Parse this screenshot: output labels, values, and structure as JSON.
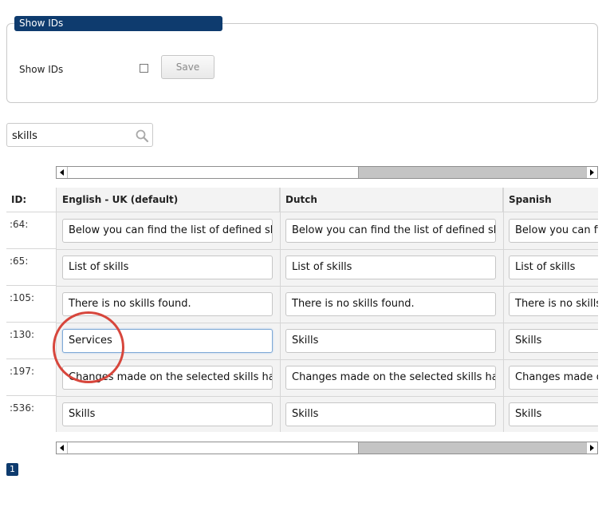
{
  "show_ids_panel": {
    "legend": "Show IDs",
    "label": "Show IDs",
    "checked": false,
    "save_label": "Save"
  },
  "search": {
    "value": "skills",
    "icon": "search-icon"
  },
  "table": {
    "id_header": "ID:",
    "columns": [
      "English - UK (default)",
      "Dutch",
      "Spanish"
    ],
    "rows": [
      {
        "id": ":64:",
        "values": [
          "Below you can find the list of defined sk",
          "Below you can find the list of defined sk",
          "Below you can fin"
        ]
      },
      {
        "id": ":65:",
        "values": [
          "List of skills",
          "List of skills",
          "List of skills"
        ]
      },
      {
        "id": ":105:",
        "values": [
          "There is no skills found.",
          "There is no skills found.",
          "There is no skills"
        ]
      },
      {
        "id": ":130:",
        "values": [
          "Services",
          "Skills",
          "Skills"
        ]
      },
      {
        "id": ":197:",
        "values": [
          "Changes made on the selected skills ha",
          "Changes made on the selected skills ha",
          "Changes made o"
        ]
      },
      {
        "id": ":536:",
        "values": [
          "Skills",
          "Skills",
          "Skills"
        ]
      }
    ],
    "focused_cell": {
      "row": 3,
      "column": 0
    }
  },
  "scrollbars": {
    "top": {
      "position_fraction": 0.56
    },
    "bottom": {
      "position_fraction": 0.56
    }
  },
  "pagination": {
    "current_page": "1"
  },
  "colors": {
    "brand_navy": "#0e3b6e",
    "highlight_red": "#d7463c",
    "scroll_thumb": "#c4c4c4"
  }
}
